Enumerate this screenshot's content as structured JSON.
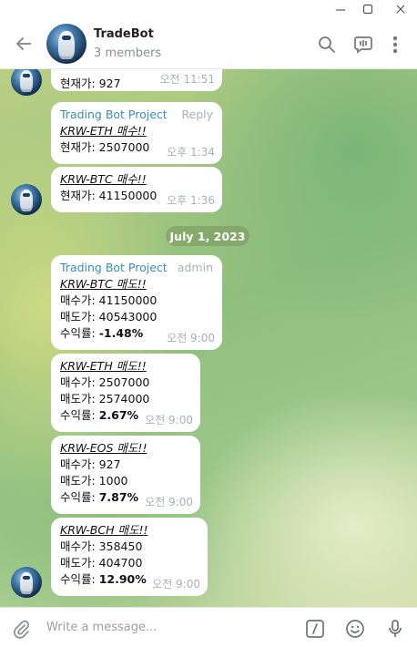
{
  "window": {
    "minimize_icon": "minimize-icon",
    "maximize_icon": "maximize-icon",
    "close_icon": "close-icon"
  },
  "header": {
    "title": "TradeBot",
    "subtitle": "3 members"
  },
  "messages": [
    {
      "header": "",
      "lines": [
        "현재가: 927"
      ],
      "time": "오전 11:51"
    },
    {
      "sender": "Trading Bot Project",
      "role": "Reply",
      "header": "KRW-ETH 매수!!",
      "lines": [
        "현재가: 2507000"
      ],
      "time": "오후 1:34"
    },
    {
      "header": "KRW-BTC 매수!!",
      "lines": [
        "현재가: 41150000"
      ],
      "time": "오후 1:36"
    },
    {
      "sender": "Trading Bot Project",
      "role": "admin",
      "header": "KRW-BTC 매도!!",
      "lines": [
        "매수가: 41150000",
        "매도가: 40543000"
      ],
      "profit_label": "수익률: ",
      "profit": "-1.48%",
      "time": "오전 9:00"
    },
    {
      "header": "KRW-ETH 매도!!",
      "lines": [
        "매수가: 2507000",
        "매도가: 2574000"
      ],
      "profit_label": "수익률: ",
      "profit": "2.67%",
      "time": "오전 9:00"
    },
    {
      "header": "KRW-EOS 매도!!",
      "lines": [
        "매수가: 927",
        "매도가: 1000"
      ],
      "profit_label": "수익률: ",
      "profit": "7.87%",
      "time": "오전 9:00"
    },
    {
      "header": "KRW-BCH 매도!!",
      "lines": [
        "매수가: 358450",
        "매도가: 404700"
      ],
      "profit_label": "수익률: ",
      "profit": "12.90%",
      "time": "오전 9:00"
    }
  ],
  "date_separator": "July 1, 2023",
  "composer": {
    "placeholder": "Write a message..."
  }
}
